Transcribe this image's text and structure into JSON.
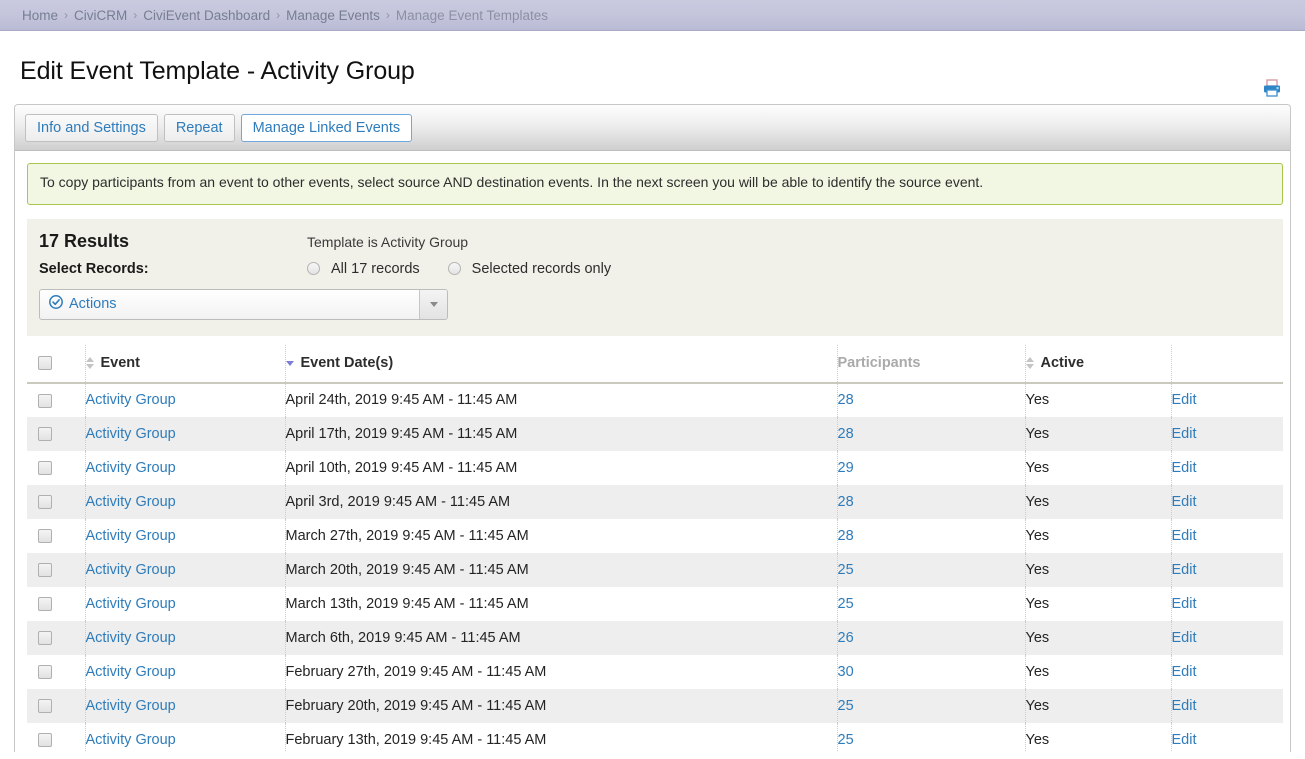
{
  "breadcrumb": {
    "items": [
      "Home",
      "CiviCRM",
      "CiviEvent Dashboard",
      "Manage Events",
      "Manage Event Templates"
    ],
    "separator": "›"
  },
  "header": {
    "title": "Edit Event Template - Activity Group",
    "print_icon": "printer-icon"
  },
  "tabs": [
    {
      "label": "Info and Settings",
      "active": false
    },
    {
      "label": "Repeat",
      "active": false
    },
    {
      "label": "Manage Linked Events",
      "active": true
    }
  ],
  "message": "To copy participants from an event to other events, select source AND destination events. In the next screen you will be able to identify the source event.",
  "results": {
    "count_label": "17 Results",
    "template_label": "Template is Activity Group",
    "select_records_label": "Select Records:",
    "radio_all": "All 17 records",
    "radio_selected": "Selected records only",
    "actions_label": "Actions",
    "actions_icon": "check-circle-icon"
  },
  "table": {
    "columns": [
      {
        "label": "",
        "sort": "none"
      },
      {
        "label": "Event",
        "sort": "both"
      },
      {
        "label": "Event Date(s)",
        "sort": "desc"
      },
      {
        "label": "Participants",
        "sort": "none",
        "muted": true
      },
      {
        "label": "Active",
        "sort": "both"
      },
      {
        "label": "",
        "sort": "none"
      }
    ],
    "edit_label": "Edit",
    "rows": [
      {
        "event": "Activity Group",
        "date": "April 24th, 2019 9:45 AM - 11:45 AM",
        "participants": "28",
        "active": "Yes"
      },
      {
        "event": "Activity Group",
        "date": "April 17th, 2019 9:45 AM - 11:45 AM",
        "participants": "28",
        "active": "Yes"
      },
      {
        "event": "Activity Group",
        "date": "April 10th, 2019 9:45 AM - 11:45 AM",
        "participants": "29",
        "active": "Yes"
      },
      {
        "event": "Activity Group",
        "date": "April 3rd, 2019 9:45 AM - 11:45 AM",
        "participants": "28",
        "active": "Yes"
      },
      {
        "event": "Activity Group",
        "date": "March 27th, 2019 9:45 AM - 11:45 AM",
        "participants": "28",
        "active": "Yes"
      },
      {
        "event": "Activity Group",
        "date": "March 20th, 2019 9:45 AM - 11:45 AM",
        "participants": "25",
        "active": "Yes"
      },
      {
        "event": "Activity Group",
        "date": "March 13th, 2019 9:45 AM - 11:45 AM",
        "participants": "25",
        "active": "Yes"
      },
      {
        "event": "Activity Group",
        "date": "March 6th, 2019 9:45 AM - 11:45 AM",
        "participants": "26",
        "active": "Yes"
      },
      {
        "event": "Activity Group",
        "date": "February 27th, 2019 9:45 AM - 11:45 AM",
        "participants": "30",
        "active": "Yes"
      },
      {
        "event": "Activity Group",
        "date": "February 20th, 2019 9:45 AM - 11:45 AM",
        "participants": "25",
        "active": "Yes"
      },
      {
        "event": "Activity Group",
        "date": "February 13th, 2019 9:45 AM - 11:45 AM",
        "participants": "25",
        "active": "Yes"
      }
    ]
  },
  "colors": {
    "link": "#2e7cbb",
    "breadcrumb_bg": "#c4c5dc",
    "message_border": "#a8c44a",
    "message_bg": "#f2f7e4",
    "panel_bg": "#f1f1e9",
    "sort_active": "#7b7fd6"
  }
}
